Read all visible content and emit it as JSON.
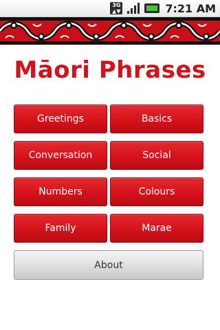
{
  "status_bar": {
    "network_label_top": "3G",
    "signal_icon": "signal-bars-icon",
    "battery_icon": "battery-charging-icon",
    "time": "7:21 AM"
  },
  "app": {
    "title": "Māori Phrases"
  },
  "menu": {
    "items": [
      {
        "label": "Greetings"
      },
      {
        "label": "Basics"
      },
      {
        "label": "Conversation"
      },
      {
        "label": "Social"
      },
      {
        "label": "Numbers"
      },
      {
        "label": "Colours"
      },
      {
        "label": "Family"
      },
      {
        "label": "Marae"
      }
    ],
    "about_label": "About"
  },
  "colors": {
    "brand_red": "#d3121c",
    "pattern_black": "#111111",
    "pattern_white": "#ffffff",
    "about_grey": "#d9d9d9"
  }
}
